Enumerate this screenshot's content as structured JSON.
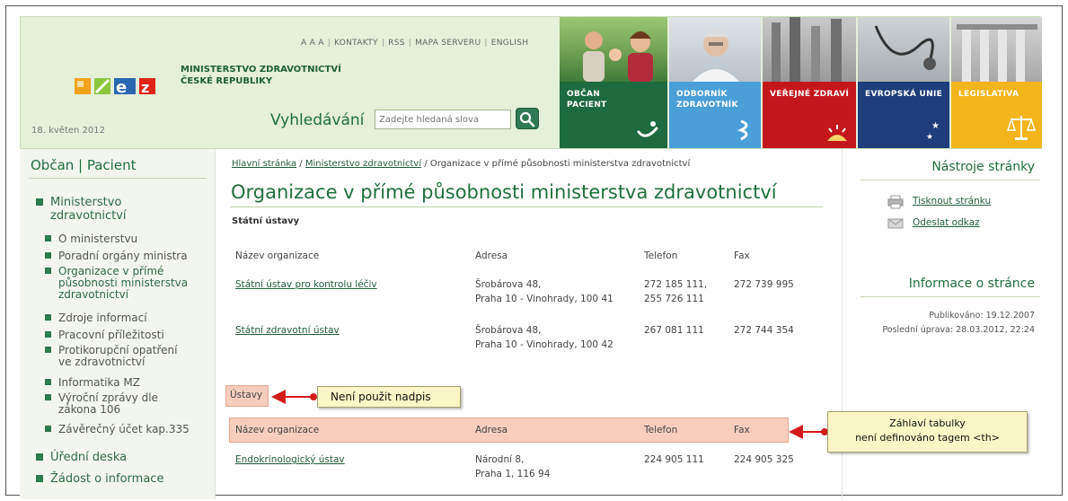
{
  "header": {
    "ministry_line1": "MINISTERSTVO ZDRAVOTNICTVÍ",
    "ministry_line2": "ČESKÉ REPUBLIKY",
    "date": "18. květen 2012",
    "topnav": [
      "A A A",
      "KONTAKTY",
      "RSS",
      "MAPA SERVERU",
      "ENGLISH"
    ],
    "search": {
      "label": "Vyhledávání",
      "placeholder": "Zadejte hledaná slova"
    },
    "tiles": [
      {
        "line1": "OBČAN",
        "line2": "PACIENT",
        "color": "#1d6b3e"
      },
      {
        "line1": "ODBORNÍK",
        "line2": "ZDRAVOTNÍK",
        "color": "#4a9fd8"
      },
      {
        "line1": "VEŘEJNÉ ZDRAVÍ",
        "line2": "",
        "color": "#c4171c"
      },
      {
        "line1": "EVROPSKÁ UNIE",
        "line2": "",
        "color": "#1e3d7a"
      },
      {
        "line1": "LEGISLATIVA",
        "line2": "",
        "color": "#f4b41c"
      }
    ]
  },
  "sidebar": {
    "title": "Občan | Pacient",
    "main1": {
      "line1": "Ministerstvo",
      "line2": "zdravotnictví"
    },
    "sub": [
      {
        "lines": [
          "O ministerstvu"
        ]
      },
      {
        "lines": [
          "Poradní orgány ministra"
        ]
      },
      {
        "lines": [
          "Organizace v přímé",
          "působnosti ministerstva",
          "zdravotnictví"
        ]
      },
      {
        "lines": [
          "Zdroje informací"
        ]
      },
      {
        "lines": [
          "Pracovní příležitosti"
        ]
      },
      {
        "lines": [
          "Protikorupční opatření",
          "ve zdravotnictví"
        ]
      },
      {
        "lines": [
          "Informatika MZ"
        ]
      },
      {
        "lines": [
          "Výroční zprávy dle",
          "zákona 106"
        ]
      },
      {
        "lines": [
          "Závěrečný účet kap.335"
        ]
      }
    ],
    "main2": "Úřední deska",
    "main3": "Žádost o informace"
  },
  "breadcrumb": {
    "home": "Hlavní stránka",
    "ministry": "Ministerstvo zdravotnictví",
    "current": "Organizace v přímé působnosti ministerstva zdravotnictví",
    "sep": "/"
  },
  "page": {
    "title": "Organizace v přímé působnosti ministerstva zdravotnictví",
    "subheading": "Státní ústavy",
    "table1": {
      "headers": [
        "Název organizace",
        "Adresa",
        "Telefon",
        "Fax"
      ],
      "rows": [
        {
          "name": "Státní ústav pro kontrolu léčiv",
          "addr1": "Šrobárova 48,",
          "addr2": "Praha 10 - Vinohrady, 100 41",
          "tel1": "272 185 111,",
          "tel2": "255 726 111",
          "fax": "272 739 995"
        },
        {
          "name": "Státní zdravotní ústav",
          "addr1": "Šrobárova 48,",
          "addr2": "Praha 10 - Vinohrady, 100 42",
          "tel1": "267 081 111",
          "tel2": "",
          "fax": "272 744 354"
        }
      ]
    },
    "caption": "Ústavy",
    "table2": {
      "headers": [
        "Název organizace",
        "Adresa",
        "Telefon",
        "Fax"
      ],
      "rows": [
        {
          "name": "Endokrinologický ústav",
          "addr1": "Národní 8,",
          "addr2": "Praha 1, 116 94",
          "tel1": "224 905 111",
          "tel2": "",
          "fax": "224 905 325"
        }
      ]
    }
  },
  "right": {
    "tools_title": "Nástroje stránky",
    "print": "Tisknout stránku",
    "send": "Odeslat odkaz",
    "info_title": "Informace o stránce",
    "published": "Publikováno: 19.12.2007",
    "modified": "Poslední úprava: 28.03.2012, 22:24"
  },
  "callouts": {
    "caption_note": "Není použit nadpis",
    "header_note_line1": "Záhlaví tabulky",
    "header_note_line2": "není definováno tagem <th>"
  }
}
